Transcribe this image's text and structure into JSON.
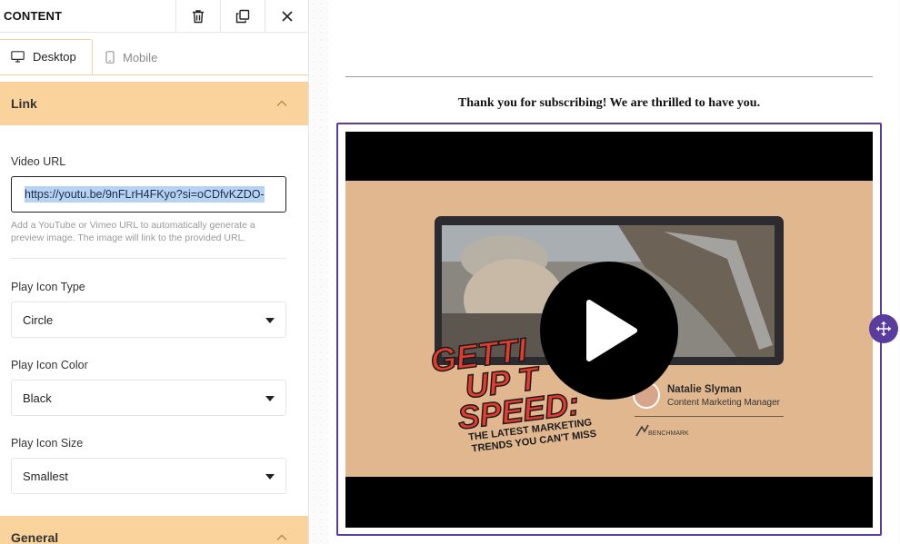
{
  "panel": {
    "title": "CONTENT",
    "tabs": [
      {
        "label": "Desktop",
        "icon": "desktop-icon",
        "active": true
      },
      {
        "label": "Mobile",
        "icon": "mobile-icon",
        "active": false
      }
    ],
    "link_section": {
      "title": "Link",
      "video_url_label": "Video URL",
      "video_url_value": "https://youtu.be/9nFLrH4FKyo?si=oCDfvKZDO-",
      "help_text": "Add a YouTube or Vimeo URL to automatically generate a preview image. The image will link to the provided URL.",
      "play_icon_type_label": "Play Icon Type",
      "play_icon_type_value": "Circle",
      "play_icon_color_label": "Play Icon Color",
      "play_icon_color_value": "Black",
      "play_icon_size_label": "Play Icon Size",
      "play_icon_size_value": "Smallest"
    },
    "general_section": {
      "title": "General"
    }
  },
  "email": {
    "thank_you_text": "Thank you for subscribing! We are thrilled to have you.",
    "video": {
      "headline_lines": [
        "GETTI",
        "UP T",
        "SPEED:"
      ],
      "subline_lines": [
        "THE LATEST MARKETING",
        "TRENDS YOU CAN'T MISS"
      ],
      "presenter_name": "Natalie Slyman",
      "presenter_title": "Content Marketing Manager",
      "brand": "BENCHMARK"
    }
  },
  "colors": {
    "accent": "#5a3b9e",
    "section_header": "#fad39c",
    "video_background": "#e0b78e",
    "headline_red": "#e63a2e"
  }
}
